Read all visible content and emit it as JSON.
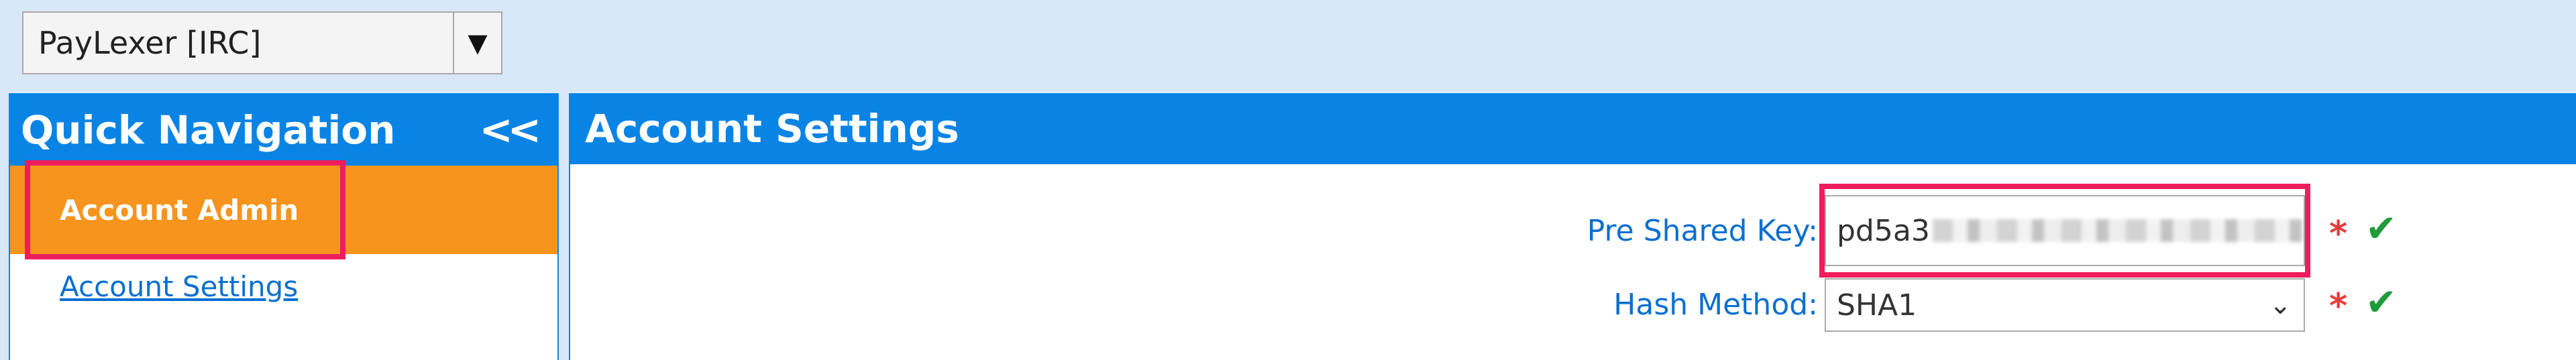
{
  "company_selector": {
    "value": "PayLexer [IRC]",
    "dropdown_icon": "triangle-down-icon"
  },
  "sidebar": {
    "title": "Quick Navigation",
    "collapse_label": "<<",
    "items": [
      {
        "label": "Account Admin",
        "active": true
      },
      {
        "label": "Account Settings",
        "active": false
      }
    ]
  },
  "main": {
    "title": "Account Settings",
    "fields": [
      {
        "label": "Pre Shared Key:",
        "value": "pd5a3"
      },
      {
        "label": "Hash Method:",
        "value": "SHA1"
      }
    ],
    "required_mark": "*",
    "valid_mark": "✔"
  },
  "colors": {
    "header_blue": "#0a84e4",
    "active_orange": "#f7941d",
    "highlight_pink": "#ef1d5e",
    "link_blue": "#0a6fd0",
    "background": "#d9e8f8"
  }
}
